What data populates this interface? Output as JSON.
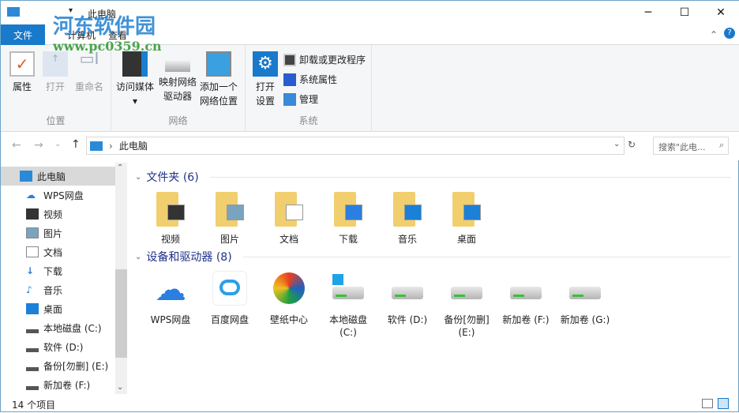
{
  "window": {
    "title": "此电脑",
    "minimize": "─",
    "maximize": "☐",
    "close": "✕"
  },
  "watermark": {
    "name": "河东软件园",
    "url": "www.pc0359.cn"
  },
  "tabs": [
    {
      "label": "文件"
    },
    {
      "label": "计算机"
    },
    {
      "label": "查看"
    }
  ],
  "ribbon": {
    "groups": [
      {
        "label": "位置",
        "buttons": [
          "属性",
          "打开",
          "重命名"
        ]
      },
      {
        "label": "网络",
        "buttons": [
          "访问媒体",
          "映射网络\n驱动器",
          "添加一个\n网络位置"
        ]
      },
      {
        "label": "系统",
        "buttons": [
          "打开\n设置"
        ],
        "small": [
          "卸载或更改程序",
          "系统属性",
          "管理"
        ]
      }
    ]
  },
  "address": {
    "path": "此电脑",
    "search_placeholder": "搜索\"此电..."
  },
  "nav": [
    {
      "label": "此电脑"
    },
    {
      "label": "WPS网盘"
    },
    {
      "label": "视频"
    },
    {
      "label": "图片"
    },
    {
      "label": "文档"
    },
    {
      "label": "下载"
    },
    {
      "label": "音乐"
    },
    {
      "label": "桌面"
    },
    {
      "label": "本地磁盘 (C:)"
    },
    {
      "label": "软件 (D:)"
    },
    {
      "label": "备份[勿删] (E:)"
    },
    {
      "label": "新加卷 (F:)"
    }
  ],
  "folders": {
    "header": "文件夹 (6)",
    "items": [
      "视频",
      "图片",
      "文档",
      "下载",
      "音乐",
      "桌面"
    ]
  },
  "devices": {
    "header": "设备和驱动器 (8)",
    "items": [
      "WPS网盘",
      "百度网盘",
      "壁纸中心",
      "本地磁盘\n(C:)",
      "软件 (D:)",
      "备份[勿删]\n(E:)",
      "新加卷 (F:)",
      "新加卷 (G:)"
    ]
  },
  "status": {
    "count": "14 个项目"
  }
}
